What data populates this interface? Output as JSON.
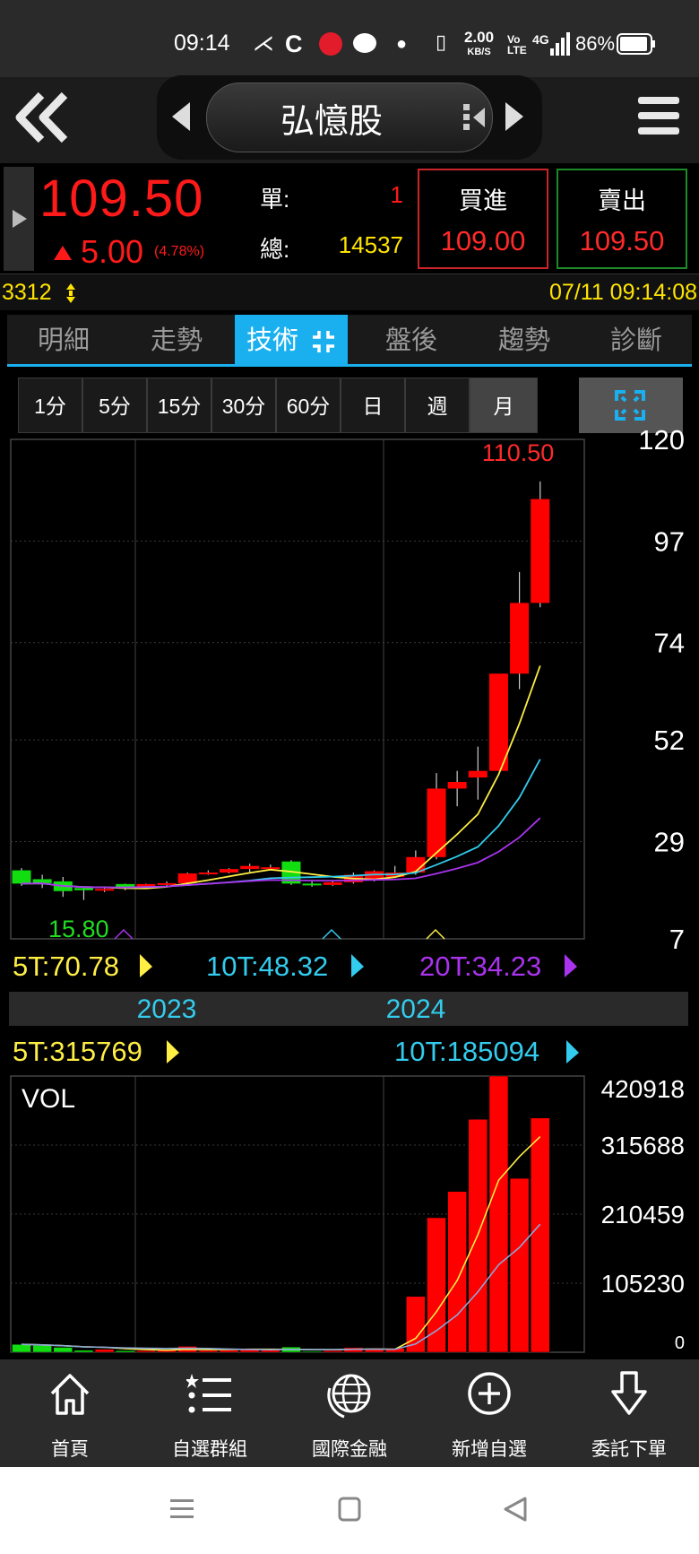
{
  "status_bar": {
    "time": "09:14",
    "net_speed_top": "2.00",
    "net_speed_unit": "KB/S",
    "volte": "Vo LTE",
    "network": "4G",
    "battery": "86%"
  },
  "header": {
    "title": "弘憶股"
  },
  "quote": {
    "price": "109.50",
    "change": "5.00",
    "change_pct": "(4.78%)",
    "unit_label": "單:",
    "unit_value": "1",
    "total_label": "總:",
    "total_value": "14537",
    "buy_label": "買進",
    "buy_price": "109.00",
    "sell_label": "賣出",
    "sell_price": "109.50"
  },
  "ticker": {
    "code": "3312",
    "datetime": "07/11 09:14:08"
  },
  "tabs": [
    {
      "label": "明細"
    },
    {
      "label": "走勢"
    },
    {
      "label": "技術"
    },
    {
      "label": "盤後"
    },
    {
      "label": "趨勢"
    },
    {
      "label": "診斷"
    }
  ],
  "periods": [
    "1分",
    "5分",
    "15分",
    "30分",
    "60分",
    "日",
    "週",
    "月"
  ],
  "active_period": "月",
  "colors": {
    "up": "#ff0000",
    "down": "#11dd11",
    "ma5": "#ffee44",
    "ma10": "#33ccee",
    "ma20": "#aa33ee",
    "accent": "#1ab0ef"
  },
  "chart_data": [
    {
      "type": "candlestick",
      "period": "monthly",
      "high_label": "110.50",
      "low_label": "15.80",
      "y_ticks": [
        "120",
        "97",
        "74",
        "52",
        "29",
        "7"
      ],
      "ylim": [
        7,
        120
      ],
      "x_labels": [
        "2023",
        "2024"
      ],
      "ma_legend": [
        {
          "name": "5T",
          "value": "70.78",
          "color": "#ffee44"
        },
        {
          "name": "10T",
          "value": "48.32",
          "color": "#33ccee"
        },
        {
          "name": "20T",
          "value": "34.23",
          "color": "#aa33ee"
        }
      ],
      "candles": [
        {
          "o": 22.5,
          "h": 23.0,
          "c": 19.5,
          "l": 19.0
        },
        {
          "o": 20.5,
          "h": 21.5,
          "c": 19.6,
          "l": 18.5
        },
        {
          "o": 20.0,
          "h": 21.0,
          "c": 17.8,
          "l": 16.5
        },
        {
          "o": 18.5,
          "h": 18.8,
          "c": 18.0,
          "l": 15.8
        },
        {
          "o": 18.0,
          "h": 18.6,
          "c": 18.3,
          "l": 17.6
        },
        {
          "o": 19.4,
          "h": 19.5,
          "c": 18.6,
          "l": 18.0
        },
        {
          "o": 18.6,
          "h": 19.5,
          "c": 19.4,
          "l": 18.5
        },
        {
          "o": 19.4,
          "h": 20.0,
          "c": 19.6,
          "l": 19.0
        },
        {
          "o": 19.6,
          "h": 22.0,
          "c": 21.8,
          "l": 19.4
        },
        {
          "o": 21.8,
          "h": 22.5,
          "c": 22.0,
          "l": 21.5
        },
        {
          "o": 22.0,
          "h": 23.0,
          "c": 22.8,
          "l": 21.8
        },
        {
          "o": 22.8,
          "h": 24.0,
          "c": 23.5,
          "l": 22.0
        },
        {
          "o": 23.0,
          "h": 23.8,
          "c": 23.2,
          "l": 22.6
        },
        {
          "o": 24.5,
          "h": 24.8,
          "c": 19.5,
          "l": 19.2
        },
        {
          "o": 19.5,
          "h": 20.0,
          "c": 19.2,
          "l": 18.8
        },
        {
          "o": 19.2,
          "h": 20.0,
          "c": 19.8,
          "l": 19.0
        },
        {
          "o": 19.8,
          "h": 22.0,
          "c": 21.5,
          "l": 19.5
        },
        {
          "o": 20.5,
          "h": 22.5,
          "c": 22.3,
          "l": 20.0
        },
        {
          "o": 21.0,
          "h": 23.5,
          "c": 22.0,
          "l": 20.8
        },
        {
          "o": 22.0,
          "h": 27.0,
          "c": 25.5,
          "l": 21.5
        },
        {
          "o": 25.5,
          "h": 44.5,
          "c": 41.0,
          "l": 25.0
        },
        {
          "o": 41.0,
          "h": 45.0,
          "c": 42.5,
          "l": 37.0
        },
        {
          "o": 43.5,
          "h": 50.5,
          "c": 45.0,
          "l": 38.5
        },
        {
          "o": 45.0,
          "h": 66.5,
          "c": 67.0,
          "l": 45.0
        },
        {
          "o": 67.0,
          "h": 90.0,
          "c": 83.0,
          "l": 63.5
        },
        {
          "o": 83.0,
          "h": 110.5,
          "c": 106.5,
          "l": 82.0
        }
      ]
    },
    {
      "type": "bar",
      "title": "VOL",
      "y_ticks": [
        "420918",
        "315688",
        "210459",
        "105230",
        "0"
      ],
      "ylim": [
        0,
        420918
      ],
      "ma_legend": [
        {
          "name": "5T",
          "value": "315769",
          "color": "#ffee44"
        },
        {
          "name": "10T",
          "value": "185094",
          "color": "#33ccee"
        }
      ],
      "values": [
        12000,
        10500,
        7500,
        3000,
        4500,
        2500,
        2500,
        3000,
        9000,
        2800,
        3200,
        4500,
        3200,
        8000,
        1500,
        2500,
        7000,
        5800,
        6000,
        85000,
        205000,
        245000,
        355000,
        420918,
        265000,
        357000
      ]
    }
  ],
  "bottom_nav": [
    {
      "label": "首頁",
      "icon": "home-icon"
    },
    {
      "label": "自選群組",
      "icon": "list-icon"
    },
    {
      "label": "國際金融",
      "icon": "globe-icon"
    },
    {
      "label": "新增自選",
      "icon": "plus-circle-icon"
    },
    {
      "label": "委託下單",
      "icon": "order-arrow-icon"
    }
  ]
}
